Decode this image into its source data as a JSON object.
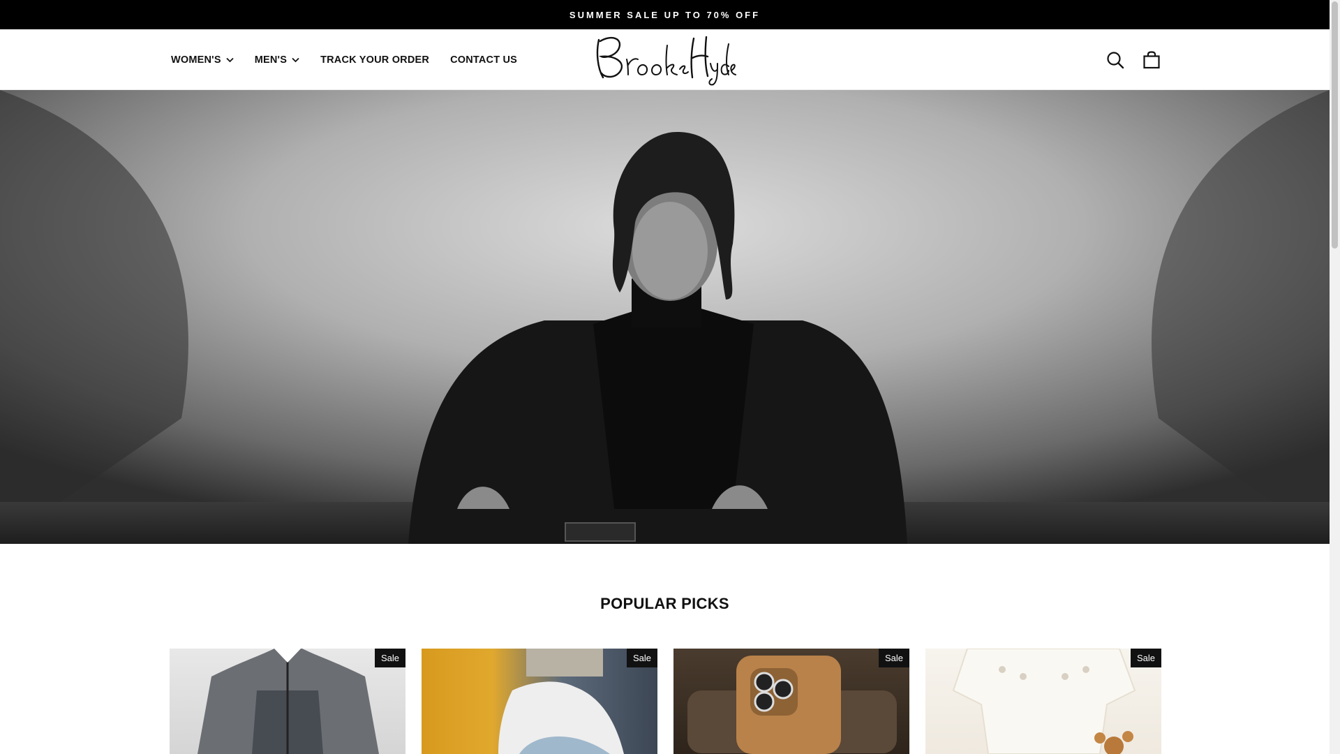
{
  "announcement": {
    "text": "SUMMER SALE UP TO 70% OFF"
  },
  "nav": {
    "items": [
      {
        "label": "WOMEN'S",
        "has_dropdown": true
      },
      {
        "label": "MEN'S",
        "has_dropdown": true
      },
      {
        "label": "TRACK YOUR ORDER",
        "has_dropdown": false
      },
      {
        "label": "CONTACT US",
        "has_dropdown": false
      }
    ]
  },
  "logo": {
    "text": "Brooks Hyde"
  },
  "header_icons": [
    "search-icon",
    "shopping-bag-icon"
  ],
  "section": {
    "title": "POPULAR PICKS"
  },
  "products": [
    {
      "badge": "Sale"
    },
    {
      "badge": "Sale"
    },
    {
      "badge": "Sale"
    },
    {
      "badge": "Sale"
    }
  ],
  "colors": {
    "announcement_bg": "#000000",
    "badge_bg": "#111111",
    "text": "#111111"
  }
}
